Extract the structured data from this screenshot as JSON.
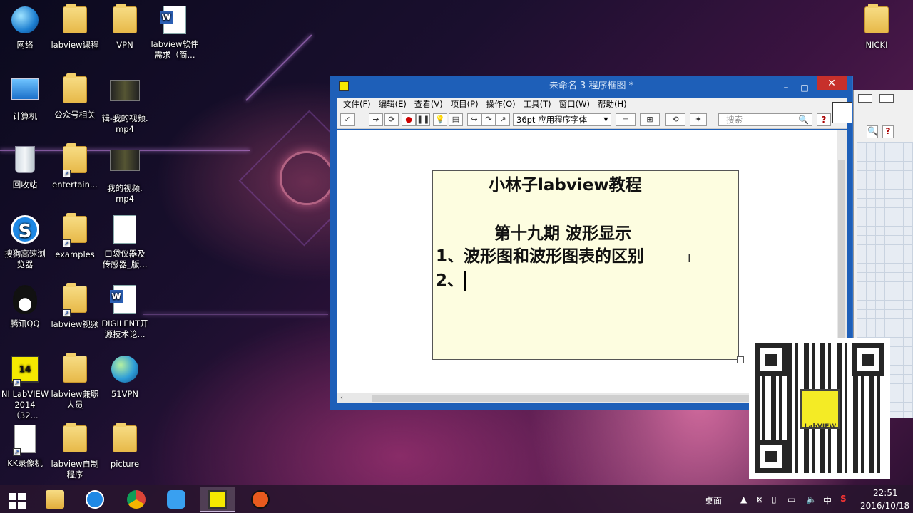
{
  "desktop": {
    "icons": [
      {
        "label": "网络"
      },
      {
        "label": "labview课程"
      },
      {
        "label": "VPN"
      },
      {
        "label": "labview软件\n需求（简..."
      },
      {
        "label": "计算机"
      },
      {
        "label": "公众号相关"
      },
      {
        "label": "辑-我的视频.\nmp4"
      },
      {
        "label": "回收站"
      },
      {
        "label": "entertain..."
      },
      {
        "label": "我的视频.\nmp4"
      },
      {
        "label": "搜狗高速浏\n览器"
      },
      {
        "label": "examples"
      },
      {
        "label": "口袋仪器及\n传感器_版..."
      },
      {
        "label": "腾讯QQ"
      },
      {
        "label": "labview视频"
      },
      {
        "label": "DIGILENT开\n源技术论..."
      },
      {
        "label": "NI LabVIEW\n2014 （32..."
      },
      {
        "label": "labview兼职\n人员"
      },
      {
        "label": "51VPN"
      },
      {
        "label": "KK录像机"
      },
      {
        "label": "labview自制\n程序"
      },
      {
        "label": "picture"
      },
      {
        "label": "NICKI"
      }
    ]
  },
  "lv_window": {
    "title": "未命名 3 程序框图 *",
    "menu": [
      "文件(F)",
      "编辑(E)",
      "查看(V)",
      "项目(P)",
      "操作(O)",
      "工具(T)",
      "窗口(W)",
      "帮助(H)"
    ],
    "font_select": "36pt 应用程序字体",
    "search_placeholder": "搜索",
    "note": {
      "line1": "小林子labview教程",
      "line2": "第十九期  波形显示",
      "line3": "1、波形图和波形图表的区别",
      "line4": "2、"
    }
  },
  "qr": {
    "brand": "LabVIEW"
  },
  "taskbar": {
    "desktop_label": "桌面",
    "ime": "中",
    "time": "22:51",
    "date": "2016/10/18"
  },
  "colors": {
    "titlebar": "#1e5fb8",
    "close": "#c7302b",
    "note_bg": "#fdfde0"
  }
}
